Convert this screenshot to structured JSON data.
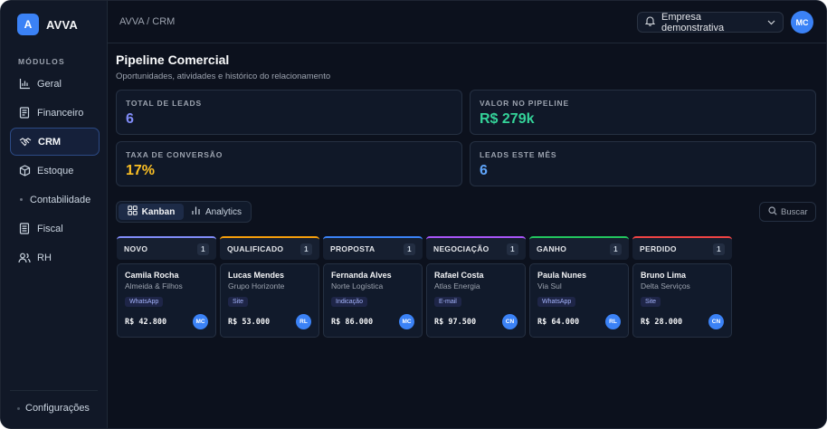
{
  "app": {
    "logo_letter": "A",
    "name": "AVVA"
  },
  "sidebar": {
    "section_label": "MÓDULOS",
    "items": [
      {
        "label": "Geral",
        "icon": "bar-chart-icon"
      },
      {
        "label": "Financeiro",
        "icon": "receipt-icon"
      },
      {
        "label": "CRM",
        "icon": "handshake-icon",
        "active": true
      },
      {
        "label": "Estoque",
        "icon": "box-icon"
      },
      {
        "label": "Contabilidade",
        "icon": "dot-icon"
      },
      {
        "label": "Fiscal",
        "icon": "document-icon"
      },
      {
        "label": "RH",
        "icon": "users-icon"
      }
    ],
    "settings_label": "Configurações"
  },
  "header": {
    "breadcrumb": "AVVA / CRM",
    "company": "Empresa demonstrativa",
    "user_initials": "MC"
  },
  "page": {
    "title": "Pipeline Comercial",
    "subtitle": "Oportunidades, atividades e histórico do relacionamento"
  },
  "stats": [
    {
      "label": "TOTAL DE LEADS",
      "value": "6",
      "color": "#818cf8"
    },
    {
      "label": "VALOR NO PIPELINE",
      "value": "R$ 279k",
      "color": "#34d399"
    },
    {
      "label": "TAXA DE CONVERSÃO",
      "value": "17%",
      "color": "#fbbf24"
    },
    {
      "label": "LEADS ESTE MÊS",
      "value": "6",
      "color": "#60a5fa"
    }
  ],
  "tabs": [
    {
      "label": "Kanban",
      "icon": "grid-icon",
      "active": true
    },
    {
      "label": "Analytics",
      "icon": "bar-chart-icon"
    }
  ],
  "search": {
    "placeholder": "Buscar"
  },
  "columns": [
    {
      "title": "NOVO",
      "count": "1",
      "color": "#818cf8",
      "card": {
        "name": "Camila Rocha",
        "company": "Almeida & Filhos",
        "source": "WhatsApp",
        "amount": "R$ 42.800",
        "owner": "MC"
      }
    },
    {
      "title": "QUALIFICADO",
      "count": "1",
      "color": "#f59e0b",
      "card": {
        "name": "Lucas Mendes",
        "company": "Grupo Horizonte",
        "source": "Site",
        "amount": "R$ 53.000",
        "owner": "RL"
      }
    },
    {
      "title": "PROPOSTA",
      "count": "1",
      "color": "#3b82f6",
      "card": {
        "name": "Fernanda Alves",
        "company": "Norte Logística",
        "source": "Indicação",
        "amount": "R$ 86.000",
        "owner": "MC"
      }
    },
    {
      "title": "NEGOCIAÇÃO",
      "count": "1",
      "color": "#a855f7",
      "card": {
        "name": "Rafael Costa",
        "company": "Atlas Energia",
        "source": "E-mail",
        "amount": "R$ 97.500",
        "owner": "CN"
      }
    },
    {
      "title": "GANHO",
      "count": "1",
      "color": "#22c55e",
      "card": {
        "name": "Paula Nunes",
        "company": "Via Sul",
        "source": "WhatsApp",
        "amount": "R$ 64.000",
        "owner": "RL"
      }
    },
    {
      "title": "PERDIDO",
      "count": "1",
      "color": "#ef4444",
      "card": {
        "name": "Bruno Lima",
        "company": "Delta Serviços",
        "source": "Site",
        "amount": "R$ 28.000",
        "owner": "CN"
      }
    }
  ]
}
